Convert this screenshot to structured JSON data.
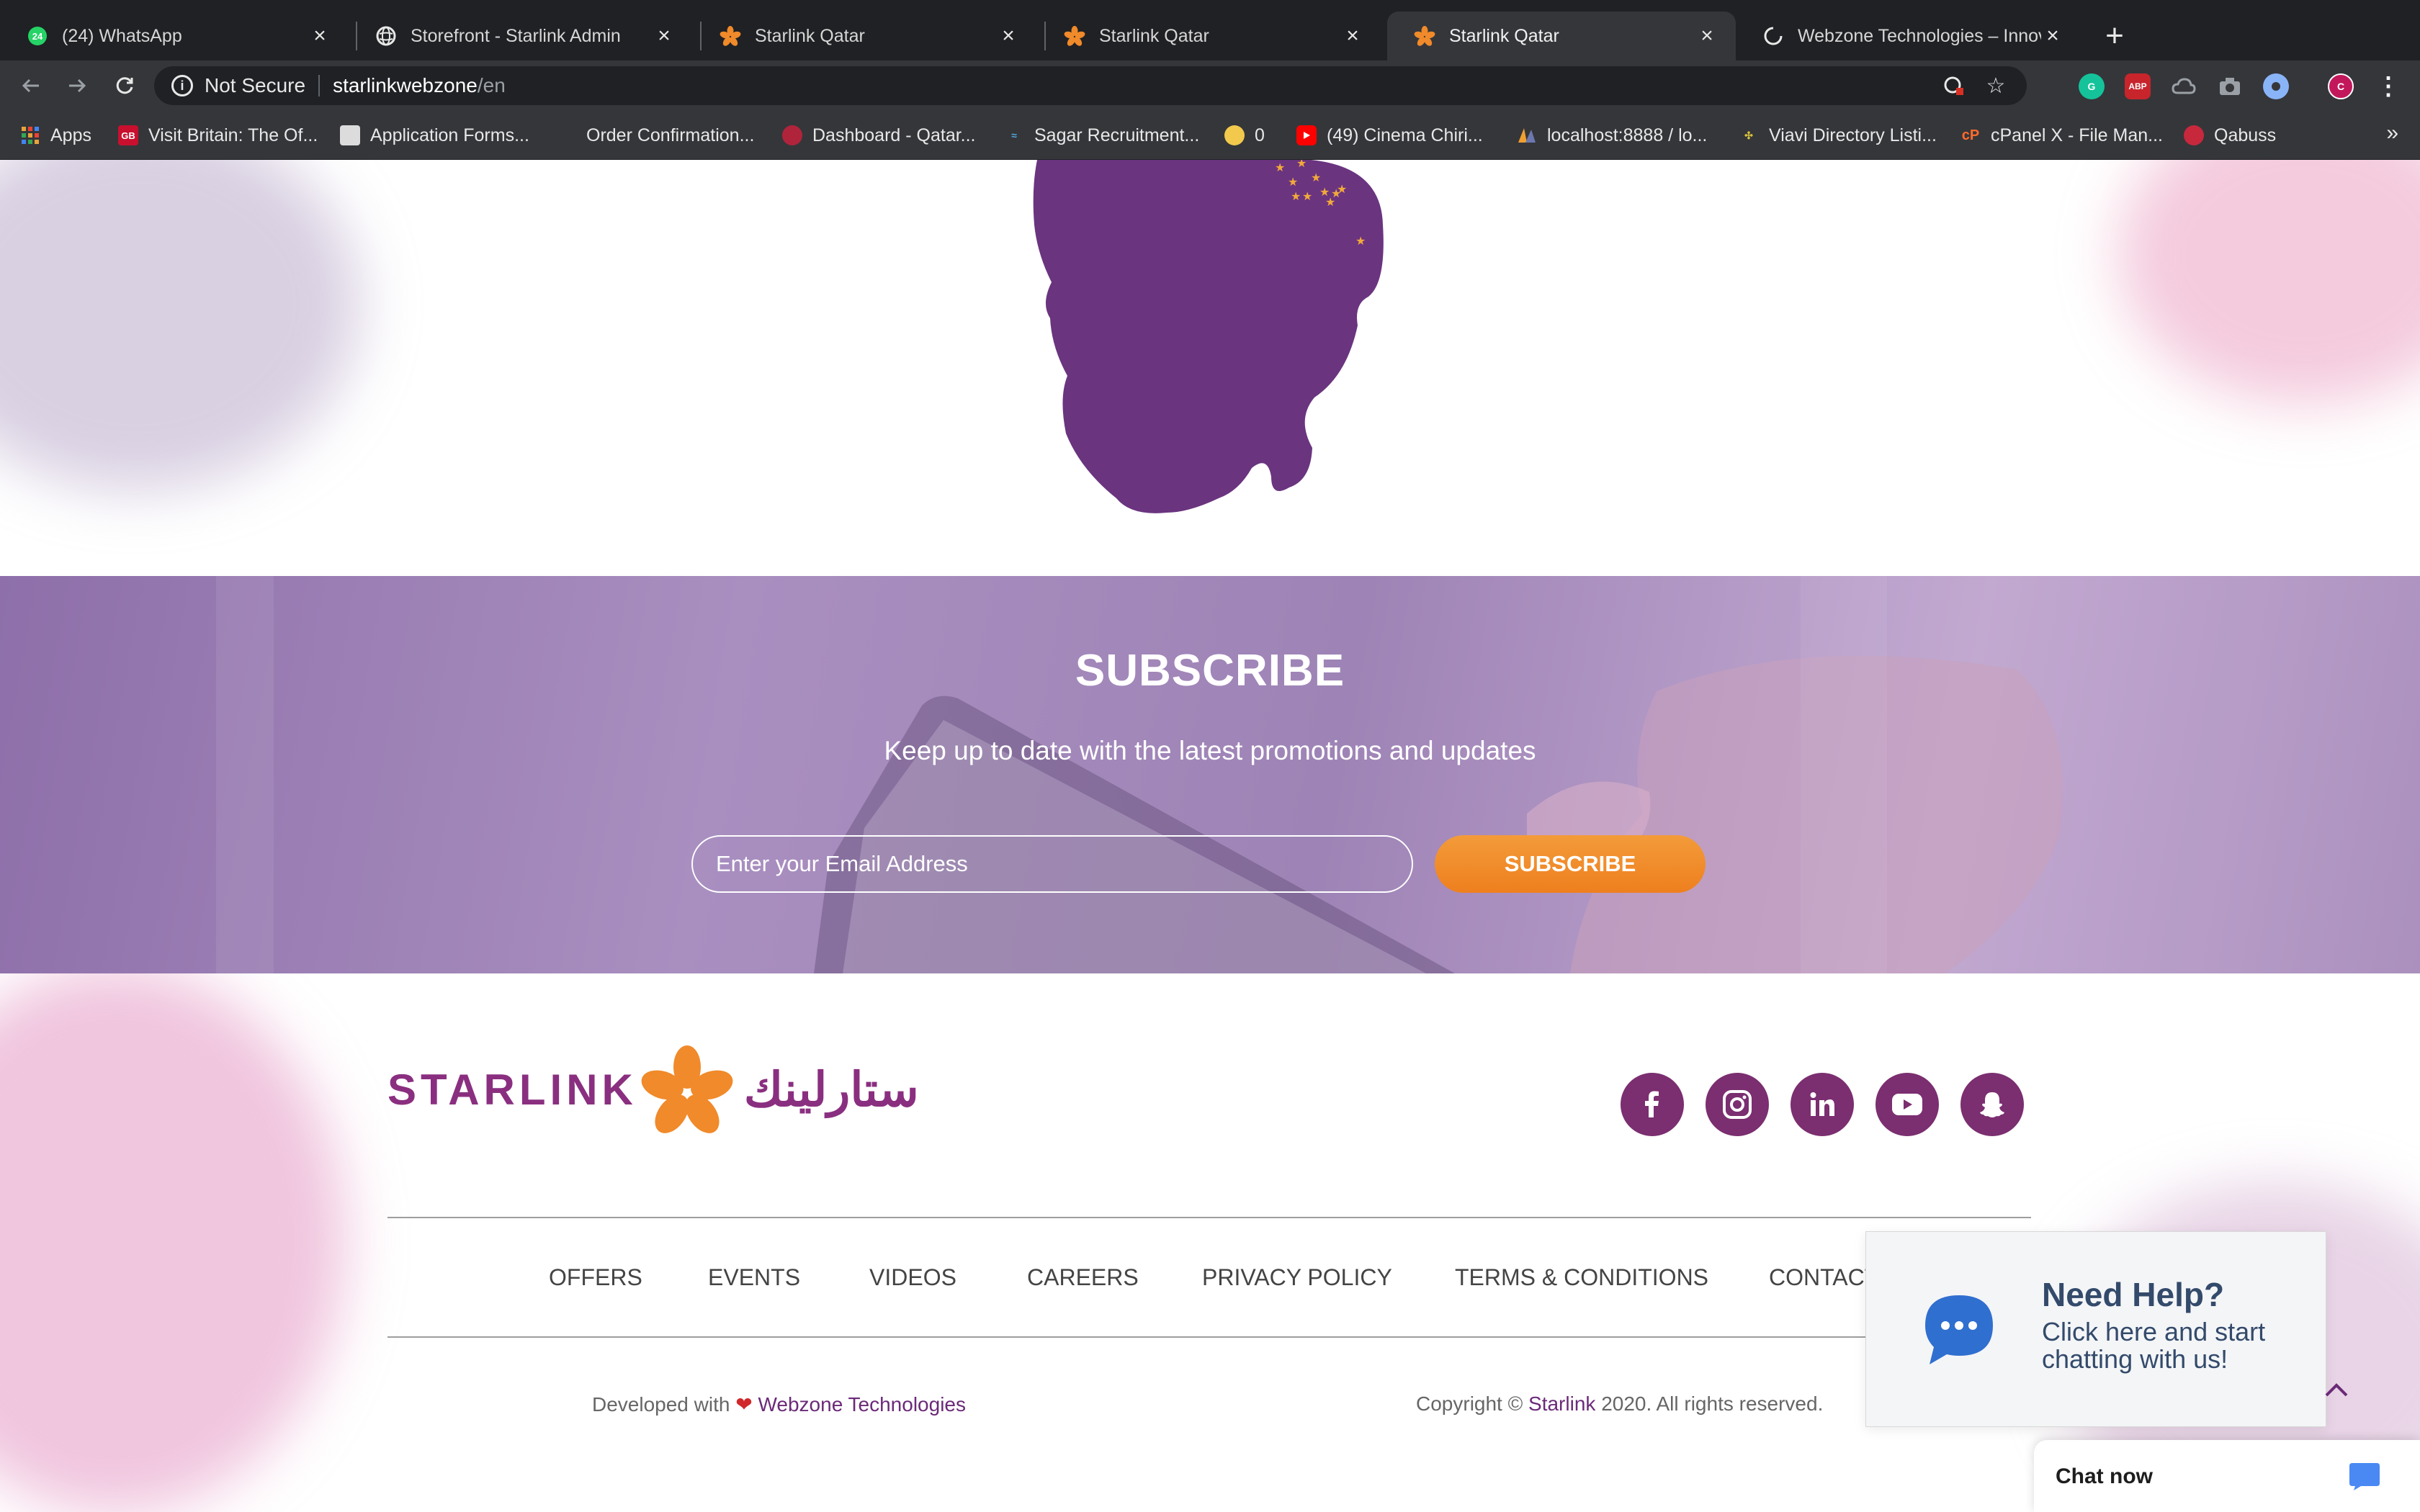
{
  "browser": {
    "tabs": [
      {
        "title": "(24) WhatsApp",
        "icon": "whatsapp-icon",
        "badge": "24"
      },
      {
        "title": "Storefront - Starlink Admin",
        "icon": "globe-icon"
      },
      {
        "title": "Starlink Qatar",
        "icon": "starlink-star-icon"
      },
      {
        "title": "Starlink Qatar",
        "icon": "starlink-star-icon"
      },
      {
        "title": "Starlink Qatar",
        "icon": "starlink-star-icon",
        "active": true
      },
      {
        "title": "Webzone Technologies – Innovat",
        "icon": "loading-icon"
      }
    ],
    "address": {
      "security_label": "Not Secure",
      "host": "starlinkwebzone",
      "path": "/en"
    },
    "bookmarks": [
      {
        "label": "Apps",
        "icon": "apps-grid-icon"
      },
      {
        "label": "Visit Britain: The Of...",
        "icon": "gb-icon",
        "icon_text": "GB"
      },
      {
        "label": "Application Forms...",
        "icon": "form-icon"
      },
      {
        "label": "Order Confirmation...",
        "icon": "apple-icon"
      },
      {
        "label": "Dashboard - Qatar...",
        "icon": "dashboard-icon"
      },
      {
        "label": "Sagar Recruitment...",
        "icon": "sagar-icon"
      },
      {
        "label": "0",
        "icon": "counter-icon"
      },
      {
        "label": "(49) Cinema Chiri...",
        "icon": "youtube-icon"
      },
      {
        "label": "localhost:8888 / lo...",
        "icon": "phpmyadmin-icon"
      },
      {
        "label": "Viavi Directory Listi...",
        "icon": "viavi-icon"
      },
      {
        "label": "cPanel X - File Man...",
        "icon": "cpanel-icon",
        "icon_text": "cP"
      },
      {
        "label": "Qabuss",
        "icon": "qabuss-icon"
      }
    ],
    "bookmarks_more": "»",
    "profile_initial": "C"
  },
  "subscribe": {
    "title": "SUBSCRIBE",
    "subtitle": "Keep up to date with the latest promotions and updates",
    "email_placeholder": "Enter your Email Address",
    "button_label": "SUBSCRIBE"
  },
  "footer": {
    "brand_en": "STARLINK",
    "brand_ar": "ستارلينك",
    "social": [
      "facebook-icon",
      "instagram-icon",
      "linkedin-icon",
      "youtube-icon",
      "snapchat-icon"
    ],
    "links": [
      "OFFERS",
      "EVENTS",
      "VIDEOS",
      "CAREERS",
      "PRIVACY POLICY",
      "TERMS & CONDITIONS",
      "CONTACT"
    ],
    "dev_prefix": "Developed with",
    "dev_heart": "❤",
    "dev_company": "Webzone Technologies",
    "copyright_prefix": "Copyright ©",
    "copyright_brand": "Starlink",
    "copyright_suffix": "2020. All rights reserved."
  },
  "chat_widget": {
    "help_title": "Need Help?",
    "help_text": "Click here and start chatting with us!",
    "chat_now_label": "Chat now"
  },
  "colors": {
    "brand_purple": "#6b2a78",
    "accent_orange": "#ee7f1e",
    "map_purple": "#6a347f",
    "chat_blue": "#2f6fcf"
  }
}
